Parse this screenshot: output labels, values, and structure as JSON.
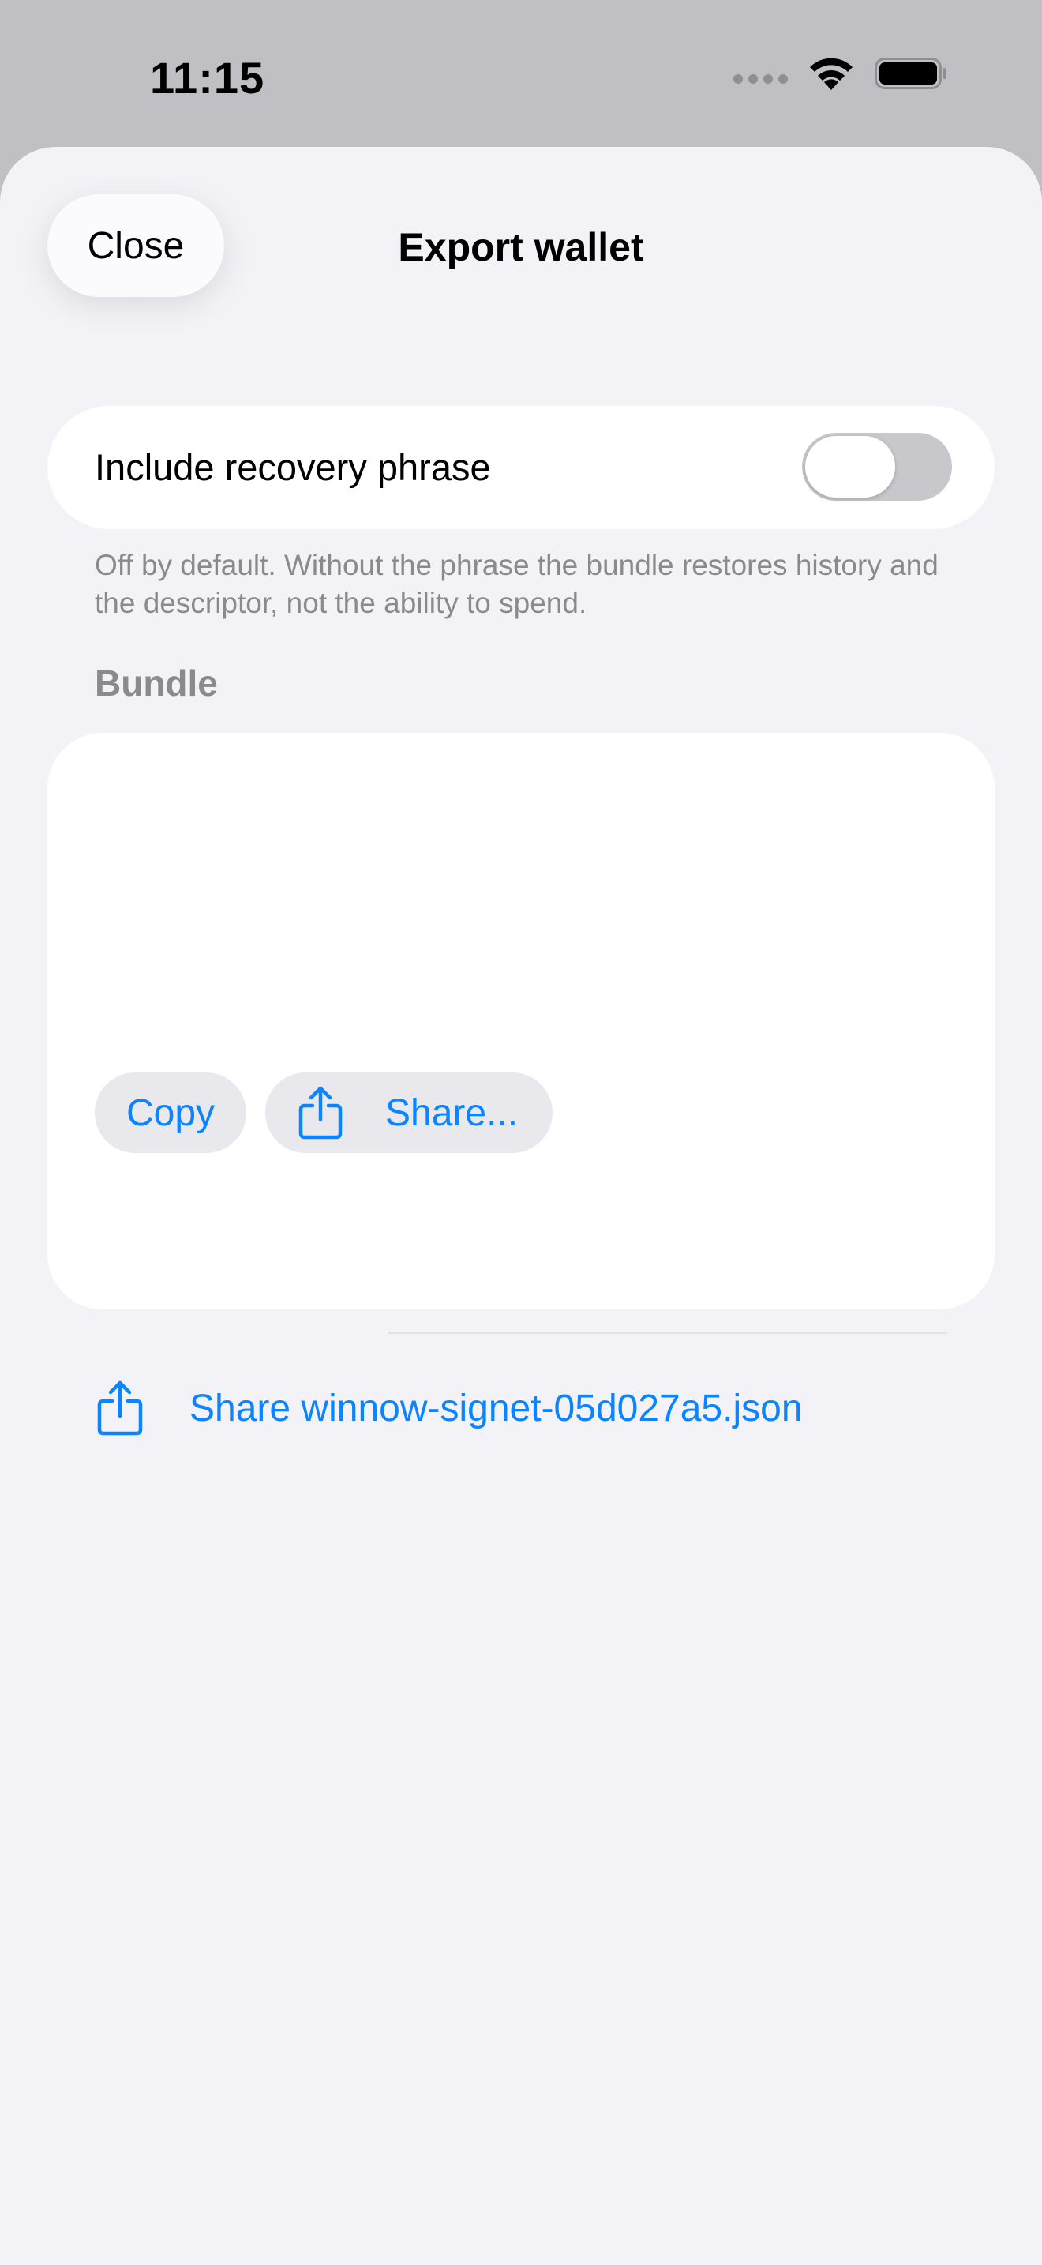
{
  "status_bar": {
    "time": "11:15"
  },
  "header": {
    "close_label": "Close",
    "title": "Export wallet"
  },
  "recovery_toggle": {
    "label": "Include recovery phrase",
    "enabled": false,
    "footnote": "Off by default. Without the phrase the bundle restores history and the descriptor, not the ability to spend."
  },
  "bundle": {
    "section_title": "Bundle",
    "copy_label": "Copy",
    "share_label": "Share...",
    "share_file_label": "Share winnow-signet-05d027a5.json"
  },
  "icons": {
    "share": "share-icon",
    "wifi": "wifi-icon",
    "battery": "battery-icon"
  },
  "colors": {
    "accent": "#0a84ff",
    "sheet_bg": "#f2f2f7",
    "card_bg": "#ffffff",
    "secondary_text": "#8a8a8e",
    "toggle_off": "#c8c8cc"
  }
}
